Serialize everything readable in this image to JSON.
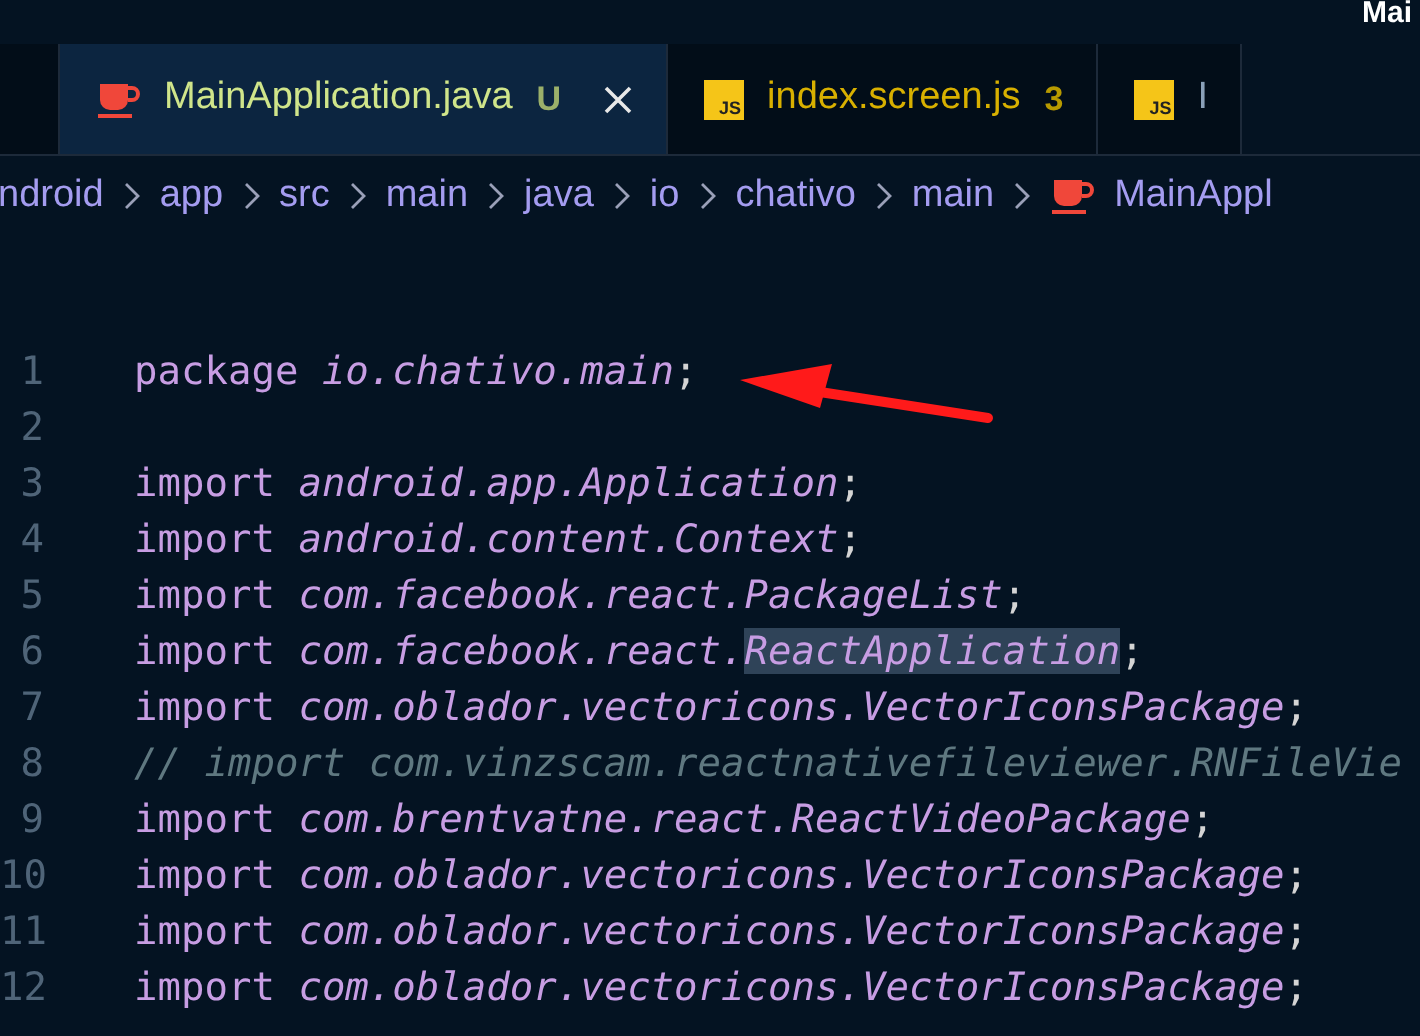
{
  "window": {
    "title": "Mai"
  },
  "tabs": [
    {
      "kind": "java",
      "label": "MainApplication.java",
      "badge": "U",
      "selected": true,
      "closable": true
    },
    {
      "kind": "js",
      "icon_text": "JS",
      "label": "index.screen.js",
      "badge": "3",
      "selected": false,
      "closable": false
    },
    {
      "kind": "js",
      "icon_text": "JS",
      "label": "I",
      "selected": false,
      "closable": false
    }
  ],
  "breadcrumbs": [
    {
      "label": "ndroid"
    },
    {
      "label": "app"
    },
    {
      "label": "src"
    },
    {
      "label": "main"
    },
    {
      "label": "java"
    },
    {
      "label": "io"
    },
    {
      "label": "chativo"
    },
    {
      "label": "main"
    },
    {
      "label": "MainAppl",
      "kind": "java"
    }
  ],
  "code_lines": [
    {
      "number": "1",
      "tokens": [
        {
          "kind": "keyword",
          "text": "package"
        },
        {
          "kind": "name",
          "text": "io.chativo.main"
        },
        {
          "kind": "punct",
          "text": ";"
        }
      ]
    },
    {
      "number": "2"
    },
    {
      "number": "3",
      "tokens": [
        {
          "kind": "keyword",
          "text": "import"
        },
        {
          "kind": "name",
          "text": "android.app.Application"
        },
        {
          "kind": "punct",
          "text": ";"
        }
      ]
    },
    {
      "number": "4",
      "tokens": [
        {
          "kind": "keyword",
          "text": "import"
        },
        {
          "kind": "name",
          "text": "android.content.Context"
        },
        {
          "kind": "punct",
          "text": ";"
        }
      ]
    },
    {
      "number": "5",
      "tokens": [
        {
          "kind": "keyword",
          "text": "import"
        },
        {
          "kind": "name",
          "text": "com.facebook.react.PackageList"
        },
        {
          "kind": "punct",
          "text": ";"
        }
      ]
    },
    {
      "number": "6",
      "tokens": [
        {
          "kind": "keyword",
          "text": "import"
        },
        {
          "kind": "name",
          "text": "com.facebook.react."
        },
        {
          "kind": "name",
          "text": "ReactApplication",
          "highlighted": true
        },
        {
          "kind": "punct",
          "text": ";"
        }
      ]
    },
    {
      "number": "7",
      "tokens": [
        {
          "kind": "keyword",
          "text": "import"
        },
        {
          "kind": "name",
          "text": "com.oblador.vectoricons.VectorIconsPackage"
        },
        {
          "kind": "punct",
          "text": ";"
        }
      ]
    },
    {
      "number": "8",
      "tokens": [
        {
          "kind": "comment",
          "text": "// import com.vinzscam.reactnativefileviewer.RNFileVie"
        }
      ]
    },
    {
      "number": "9",
      "tokens": [
        {
          "kind": "keyword",
          "text": "import"
        },
        {
          "kind": "name",
          "text": "com.brentvatne.react.ReactVideoPackage"
        },
        {
          "kind": "punct",
          "text": ";"
        }
      ]
    },
    {
      "number": "10",
      "tokens": [
        {
          "kind": "keyword",
          "text": "import"
        },
        {
          "kind": "name",
          "text": "com.oblador.vectoricons.VectorIconsPackage"
        },
        {
          "kind": "punct",
          "text": ";"
        }
      ]
    },
    {
      "number": "11",
      "tokens": [
        {
          "kind": "keyword",
          "text": "import"
        },
        {
          "kind": "name",
          "text": "com.oblador.vectoricons.VectorIconsPackage"
        },
        {
          "kind": "punct",
          "text": ";"
        }
      ]
    },
    {
      "number": "12",
      "tokens": [
        {
          "kind": "keyword",
          "text": "import"
        },
        {
          "kind": "name",
          "text": "com.oblador.vectoricons.VectorIconsPackage"
        },
        {
          "kind": "punct",
          "text": ";"
        }
      ]
    }
  ]
}
